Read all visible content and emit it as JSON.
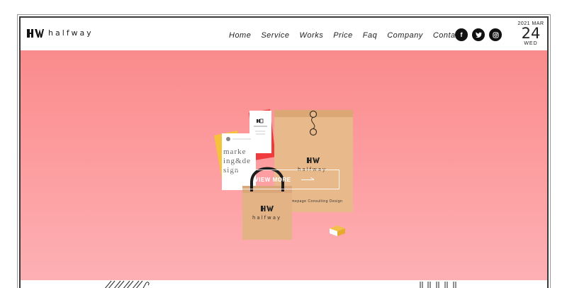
{
  "header": {
    "logo_text": "halfway",
    "nav": [
      "Home",
      "Service",
      "Works",
      "Price",
      "Faq",
      "Company",
      "Contact"
    ],
    "social": [
      {
        "icon": "facebook-icon",
        "glyph": "f"
      },
      {
        "icon": "twitter-icon",
        "glyph": "t"
      },
      {
        "icon": "instagram-icon",
        "glyph": "◎"
      }
    ]
  },
  "date": {
    "year_month": "2021 MAR",
    "day": "24",
    "weekday": "WED"
  },
  "hero": {
    "cta_label": "VIEW MORE",
    "card_text": "marketing&design",
    "bag_logo": "halfway",
    "envelope_logo": "halfway",
    "envelope_caption": "Homepage Consulting Design"
  },
  "colors": {
    "hero_top": "#fa8b8c",
    "hero_bottom": "#fdb0b4",
    "kraft": "#e8b98a"
  }
}
